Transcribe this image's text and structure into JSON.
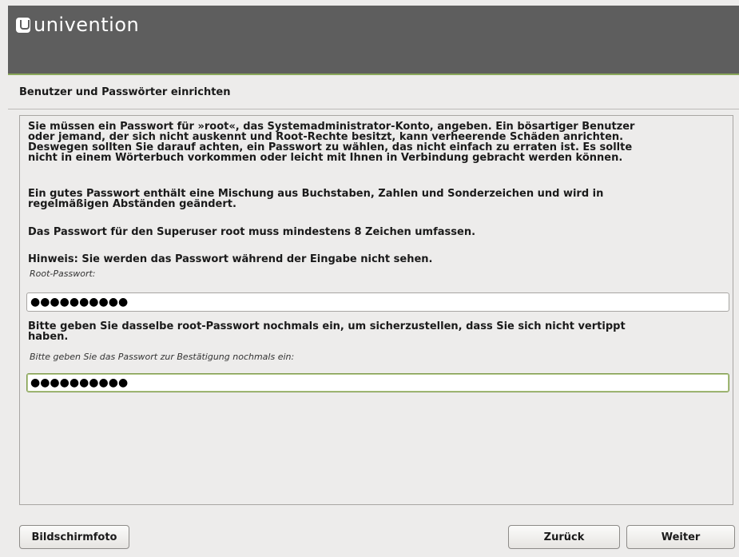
{
  "header": {
    "brand": "univention",
    "logo_icon": "univention-logo-icon"
  },
  "page": {
    "title": "Benutzer und Passwörter einrichten"
  },
  "content": {
    "para1": "Sie müssen ein Passwort für »root«, das Systemadministrator-Konto, angeben. Ein bösartiger Benutzer\noder jemand, der sich nicht auskennt und Root-Rechte besitzt, kann verheerende Schäden anrichten.\nDeswegen sollten Sie darauf achten, ein Passwort zu wählen, das nicht einfach zu erraten ist. Es sollte\nnicht in einem Wörterbuch vorkommen oder leicht mit Ihnen in Verbindung gebracht werden können.",
    "para2": "Ein gutes Passwort enthält eine Mischung aus Buchstaben, Zahlen und Sonderzeichen und wird in\nregelmäßigen Abständen geändert.",
    "para3": "Das Passwort für den Superuser root muss mindestens 8 Zeichen umfassen.",
    "para4": "Hinweis: Sie werden das Passwort während der Eingabe nicht sehen.",
    "root_password_label": "Root-Passwort:",
    "root_password_value": "●●●●●●●●●●",
    "confirm_text": "Bitte geben Sie dasselbe root-Passwort nochmals ein, um sicherzustellen, dass Sie sich nicht vertippt\nhaben.",
    "confirm_label": "Bitte geben Sie das Passwort zur Bestätigung nochmals ein:",
    "confirm_value": "●●●●●●●●●●"
  },
  "footer": {
    "screenshot_label": "Bildschirmfoto",
    "back_label": "Zurück",
    "next_label": "Weiter"
  },
  "colors": {
    "header_bg": "#5e5e5e",
    "accent_green": "#8aa85a",
    "page_bg": "#edeceb"
  }
}
